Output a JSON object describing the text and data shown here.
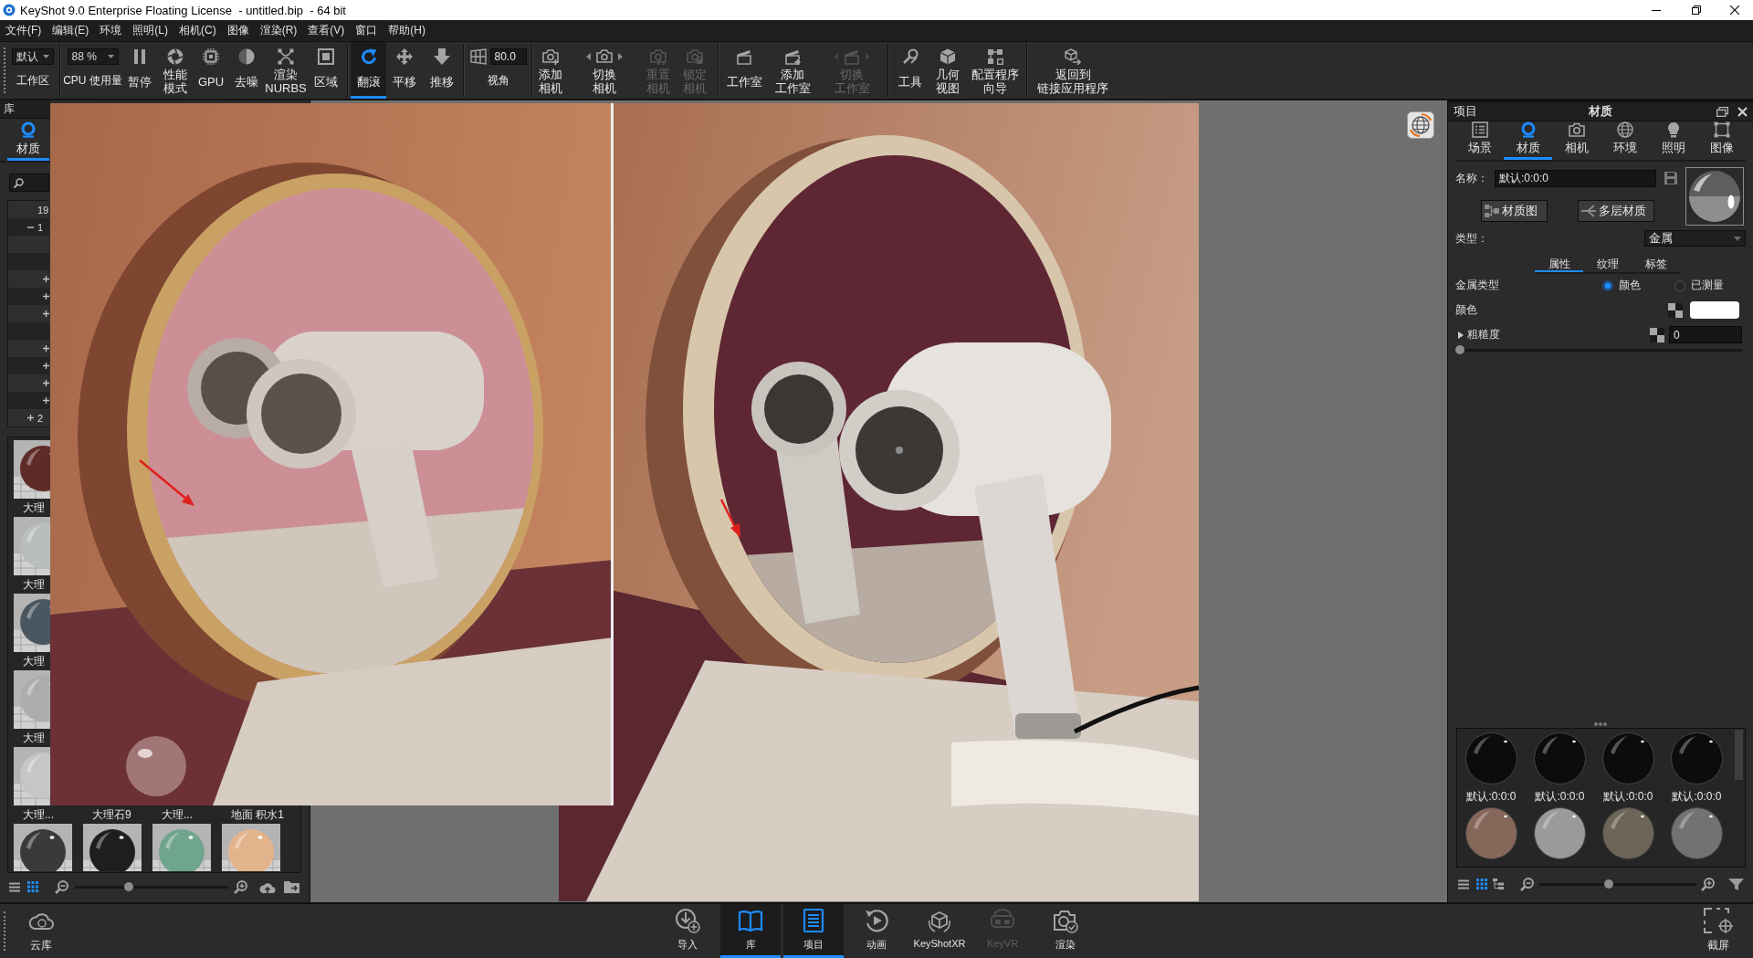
{
  "window": {
    "title": "KeyShot 9.0 Enterprise Floating License  - untitled.bip  - 64 bit"
  },
  "menu": [
    "文件(F)",
    "编辑(E)",
    "环境",
    "照明(L)",
    "相机(C)",
    "图像",
    "渲染(R)",
    "查看(V)",
    "窗口",
    "帮助(H)"
  ],
  "toolbar": [
    [
      {
        "kind": "dropdown",
        "value": "默认",
        "label": "工作区"
      }
    ],
    [
      {
        "kind": "dropdown",
        "value": "88 %",
        "label": "CPU 使用量"
      },
      {
        "kind": "button",
        "lines": [
          "暂停"
        ],
        "selected": false,
        "disabled": false
      },
      {
        "kind": "button",
        "lines": [
          "性能",
          "模式"
        ],
        "selected": false,
        "disabled": false
      },
      {
        "kind": "button",
        "lines": [
          "GPU"
        ],
        "selected": false,
        "disabled": false
      },
      {
        "kind": "button",
        "lines": [
          "去噪"
        ],
        "selected": false,
        "disabled": false
      },
      {
        "kind": "button",
        "lines": [
          "渲染",
          "NURBS"
        ],
        "selected": false,
        "disabled": false
      },
      {
        "kind": "button",
        "lines": [
          "区域"
        ],
        "selected": false,
        "disabled": false
      }
    ],
    [
      {
        "kind": "button",
        "lines": [
          "翻滚"
        ],
        "selected": true,
        "disabled": false
      },
      {
        "kind": "button",
        "lines": [
          "平移"
        ],
        "selected": false,
        "disabled": false
      },
      {
        "kind": "button",
        "lines": [
          "推移"
        ],
        "selected": false,
        "disabled": false
      }
    ],
    [
      {
        "kind": "field",
        "value": "80.0",
        "label": "视角"
      }
    ],
    [
      {
        "kind": "button",
        "lines": [
          "添加",
          "相机"
        ],
        "selected": false,
        "disabled": false
      },
      {
        "kind": "switcher",
        "lines": [
          "切换",
          "相机"
        ],
        "selected": false,
        "disabled": false
      },
      {
        "kind": "button",
        "lines": [
          "重置",
          "相机"
        ],
        "selected": false,
        "disabled": true
      },
      {
        "kind": "button",
        "lines": [
          "锁定",
          "相机"
        ],
        "selected": false,
        "disabled": true
      }
    ],
    [
      {
        "kind": "button",
        "lines": [
          "工作室"
        ],
        "selected": false,
        "disabled": false
      },
      {
        "kind": "button",
        "lines": [
          "添加",
          "工作室"
        ],
        "selected": false,
        "disabled": false
      },
      {
        "kind": "switcher",
        "lines": [
          "切换",
          "工作室"
        ],
        "selected": false,
        "disabled": true
      }
    ],
    [
      {
        "kind": "button",
        "lines": [
          "工具"
        ],
        "selected": false,
        "disabled": false
      },
      {
        "kind": "button",
        "lines": [
          "几何",
          "视图"
        ],
        "selected": false,
        "disabled": false
      },
      {
        "kind": "button",
        "lines": [
          "配置程序",
          "向导"
        ],
        "selected": false,
        "disabled": false
      }
    ],
    [
      {
        "kind": "button",
        "lines": [
          "返回到",
          "链接应用程序"
        ],
        "selected": false,
        "disabled": false
      }
    ]
  ],
  "library": {
    "title": "库",
    "tabs": [
      {
        "label": "材质",
        "selected": true
      }
    ],
    "tree": [
      {
        "kind": "leaf",
        "label": "19"
      },
      {
        "kind": "folder",
        "label": "1",
        "expanded": true,
        "children": [
          {
            "kind": "leaf"
          },
          {
            "kind": "leaf"
          },
          {
            "kind": "folder",
            "expanded": false
          },
          {
            "kind": "folder",
            "expanded": false
          },
          {
            "kind": "folder",
            "expanded": false
          },
          {
            "kind": "leaf"
          },
          {
            "kind": "folder",
            "expanded": false
          },
          {
            "kind": "folder",
            "expanded": false
          },
          {
            "kind": "folder",
            "expanded": false
          },
          {
            "kind": "folder",
            "expanded": false
          }
        ]
      },
      {
        "kind": "folder",
        "label": "2",
        "expanded": false
      }
    ],
    "thumbnail_rows": [
      [
        {
          "label": "大理",
          "color": "#5e2b27"
        }
      ],
      [
        {
          "label": "大理",
          "color": "#b9bdbc"
        }
      ],
      [
        {
          "label": "大理",
          "color": "#4b5760"
        }
      ],
      [
        {
          "label": "大理",
          "color": "#acaeae"
        }
      ],
      [
        {
          "label": "大理...",
          "color": "#c6c6c6"
        },
        {
          "label": "大理石9"
        },
        {
          "label": "大理..."
        },
        {
          "label": "地面 积水1"
        }
      ],
      [
        {
          "color": "#3a3a3a"
        },
        {
          "color": "#1e1e1e"
        },
        {
          "color": "#6fa58c"
        },
        {
          "color": "#e3b48c"
        }
      ]
    ],
    "view_modes": [
      {
        "selected": false
      },
      {
        "selected": true
      }
    ],
    "zoom": {
      "level": 0.34
    }
  },
  "project": {
    "title": "项目",
    "heading": "材质",
    "tabs": [
      {
        "label": "场景",
        "selected": false
      },
      {
        "label": "材质",
        "selected": true
      },
      {
        "label": "相机",
        "selected": false
      },
      {
        "label": "环境",
        "selected": false
      },
      {
        "label": "照明",
        "selected": false
      },
      {
        "label": "图像",
        "selected": false
      }
    ],
    "name": {
      "label": "名称：",
      "value": "默认:0:0:0"
    },
    "buttons": [
      "材质图",
      "多层材质"
    ],
    "type": {
      "label": "类型：",
      "value": "金属"
    },
    "subtabs": [
      {
        "label": "属性",
        "selected": true
      },
      {
        "label": "纹理",
        "selected": false
      },
      {
        "label": "标签",
        "selected": false
      }
    ],
    "properties": [
      {
        "kind": "radio",
        "label": "金属类型",
        "options": [
          {
            "label": "颜色",
            "selected": true
          },
          {
            "label": "已测量",
            "selected": false
          }
        ]
      },
      {
        "kind": "color",
        "label": "颜色",
        "color": "#ffffff"
      },
      {
        "kind": "slider",
        "label": "粗糙度",
        "expanded": false,
        "value": "0",
        "level": 0
      }
    ],
    "materials": [
      {
        "label": "默认:0:0:0",
        "color": "#0c0c0c"
      },
      {
        "label": "默认:0:0:0",
        "color": "#0c0c0c"
      },
      {
        "label": "默认:0:0:0",
        "color": "#0c0c0c"
      },
      {
        "label": "默认:0:0:0",
        "color": "#0c0c0c"
      },
      {
        "color": "#86685a"
      },
      {
        "color": "#9a9a9a"
      },
      {
        "color": "#6d6558"
      },
      {
        "color": "#727272"
      }
    ],
    "view_modes": [
      {
        "selected": false
      },
      {
        "selected": true
      },
      {
        "selected": false
      }
    ],
    "zoom": {
      "level": 0.44
    }
  },
  "bottom_bar": {
    "cloud": {
      "label": "云库"
    },
    "items": [
      {
        "label": "导入",
        "selected": false,
        "disabled": false
      },
      {
        "label": "库",
        "selected": true,
        "disabled": false
      },
      {
        "label": "项目",
        "selected": true,
        "disabled": false
      },
      {
        "label": "动画",
        "selected": false,
        "disabled": false
      },
      {
        "label": "KeyShotXR",
        "selected": false,
        "disabled": false
      },
      {
        "label": "KeyVR",
        "selected": false,
        "disabled": true
      },
      {
        "label": "渲染",
        "selected": false,
        "disabled": false
      }
    ],
    "screenshot": {
      "label": "截屏"
    }
  }
}
